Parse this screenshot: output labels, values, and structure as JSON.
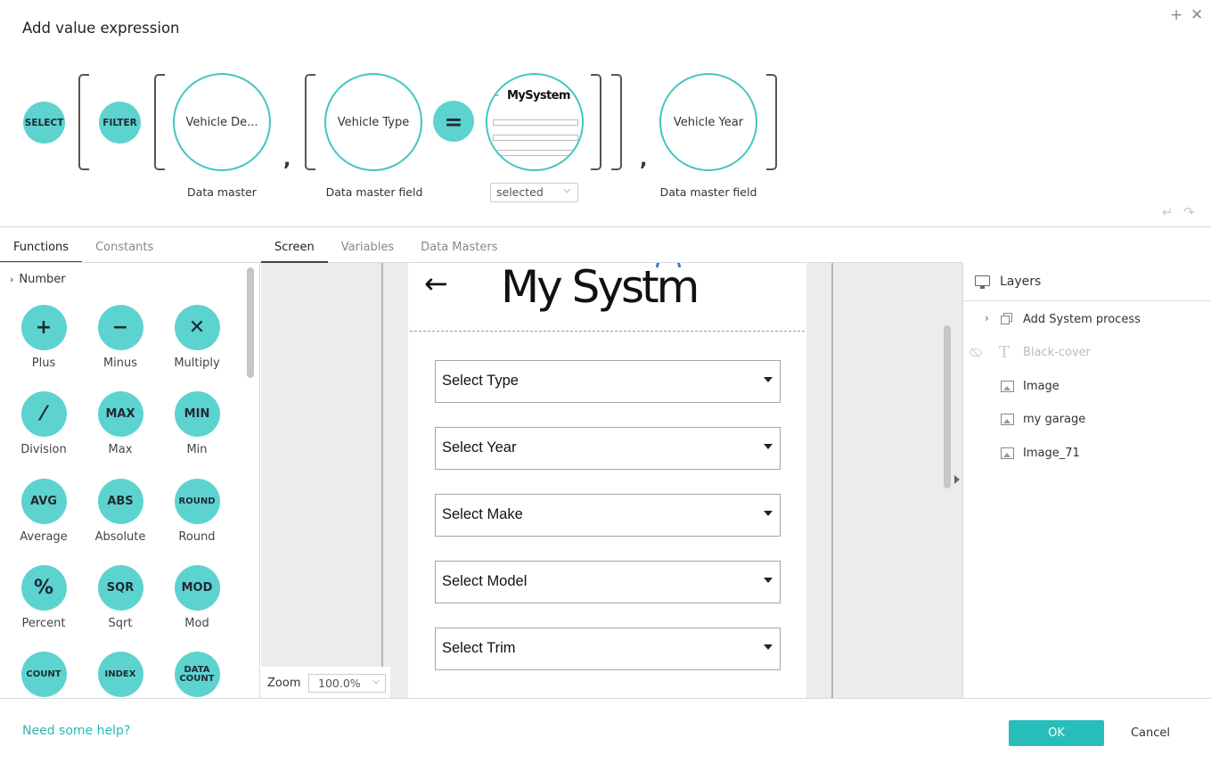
{
  "dialog": {
    "title": "Add value expression"
  },
  "expression": {
    "select_label": "SELECT",
    "filter_label": "FILTER",
    "data_master_value": "Vehicle De...",
    "data_master_caption": "Data master",
    "field1_value": "Vehicle Type",
    "field1_caption": "Data master field",
    "equals_symbol": "=",
    "thumb_logo": "MySystem",
    "thumb_arrow": "←",
    "comparison_select": "selected",
    "field2_value": "Vehicle Year",
    "field2_caption": "Data master field",
    "comma": ","
  },
  "left_tabs": [
    "Functions",
    "Constants"
  ],
  "number_section": "Number",
  "functions": [
    {
      "symbol": "+",
      "label": "Plus",
      "icon": "plus-icon"
    },
    {
      "symbol": "−",
      "label": "Minus",
      "icon": "minus-icon"
    },
    {
      "symbol": "✕",
      "label": "Multiply",
      "icon": "multiply-icon"
    },
    {
      "symbol": "⁄",
      "label": "Division",
      "icon": "division-icon"
    },
    {
      "symbol": "MAX",
      "label": "Max",
      "icon": "max-icon"
    },
    {
      "symbol": "MIN",
      "label": "Min",
      "icon": "min-icon"
    },
    {
      "symbol": "AVG",
      "label": "Average",
      "icon": "avg-icon"
    },
    {
      "symbol": "ABS",
      "label": "Absolute",
      "icon": "abs-icon"
    },
    {
      "symbol": "ROUND",
      "label": "Round",
      "icon": "round-icon"
    },
    {
      "symbol": "%",
      "label": "Percent",
      "icon": "percent-icon"
    },
    {
      "symbol": "SQR",
      "label": "Sqrt",
      "icon": "sqrt-icon"
    },
    {
      "symbol": "MOD",
      "label": "Mod",
      "icon": "mod-icon"
    },
    {
      "symbol": "COUNT",
      "label": "",
      "icon": "count-icon"
    },
    {
      "symbol": "INDEX",
      "label": "",
      "icon": "index-icon"
    },
    {
      "symbol": "DATA COUNT",
      "label": "",
      "icon": "data-count-icon"
    }
  ],
  "center_tabs": [
    "Screen",
    "Variables",
    "Data Masters"
  ],
  "screen": {
    "back_arrow": "←",
    "logo": "My Systm",
    "dropdowns": [
      "Select Type",
      "Select Year",
      "Select Make",
      "Select Model",
      "Select Trim"
    ]
  },
  "zoom": {
    "label": "Zoom",
    "value": "100.0%"
  },
  "layers": {
    "title": "Layers",
    "items": [
      {
        "label": "Add System process",
        "type": "group",
        "hidden": false
      },
      {
        "label": "Black-cover",
        "type": "text",
        "hidden": true
      },
      {
        "label": "Image",
        "type": "image",
        "hidden": false
      },
      {
        "label": "my garage",
        "type": "image",
        "hidden": false
      },
      {
        "label": "Image_71",
        "type": "image",
        "hidden": false
      }
    ]
  },
  "footer": {
    "help": "Need some help?",
    "ok": "OK",
    "cancel": "Cancel"
  },
  "colors": {
    "accent": "#28bdb9",
    "token": "#5dd3d0",
    "ring": "#43c5c1"
  }
}
